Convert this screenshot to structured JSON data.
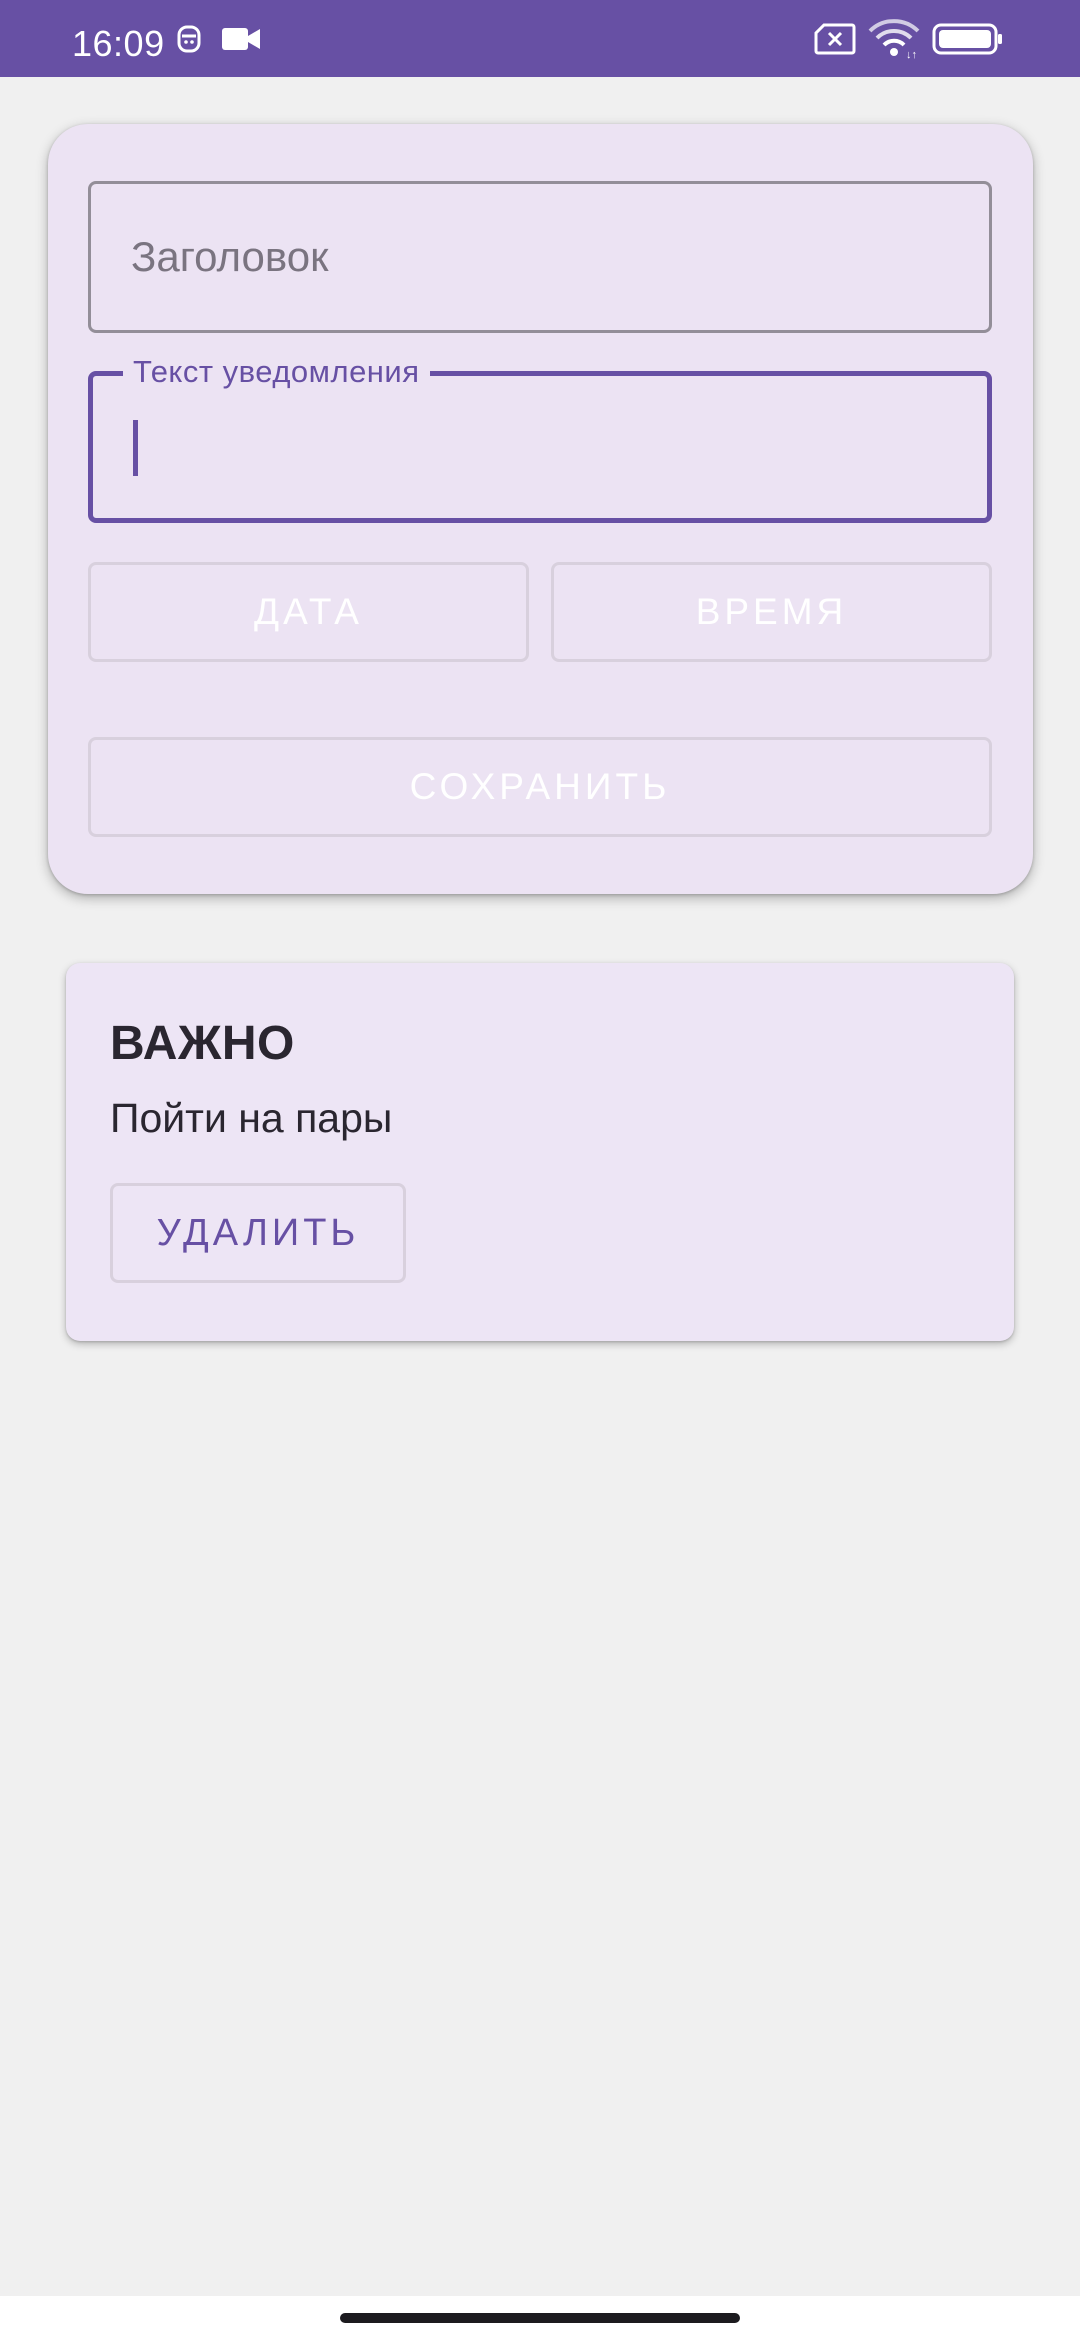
{
  "status_bar": {
    "time": "16:09",
    "icons": [
      "face-badge-icon",
      "video-camera-icon",
      "sim-x-icon",
      "wifi-icon",
      "battery-icon"
    ],
    "background": "#6750a4"
  },
  "form": {
    "title_placeholder": "Заголовок",
    "text_label": "Текст уведомления",
    "text_value": "",
    "date_button": "ДАТА",
    "time_button": "ВРЕМЯ",
    "save_button": "СОХРАНИТЬ"
  },
  "notifications": [
    {
      "title": "ВАЖНО",
      "body": "Пойти на пары",
      "delete_button": "УДАЛИТЬ"
    }
  ],
  "colors": {
    "primary": "#6750a4",
    "card_background": "#ece3f3",
    "page_background": "#f0f0f0"
  }
}
